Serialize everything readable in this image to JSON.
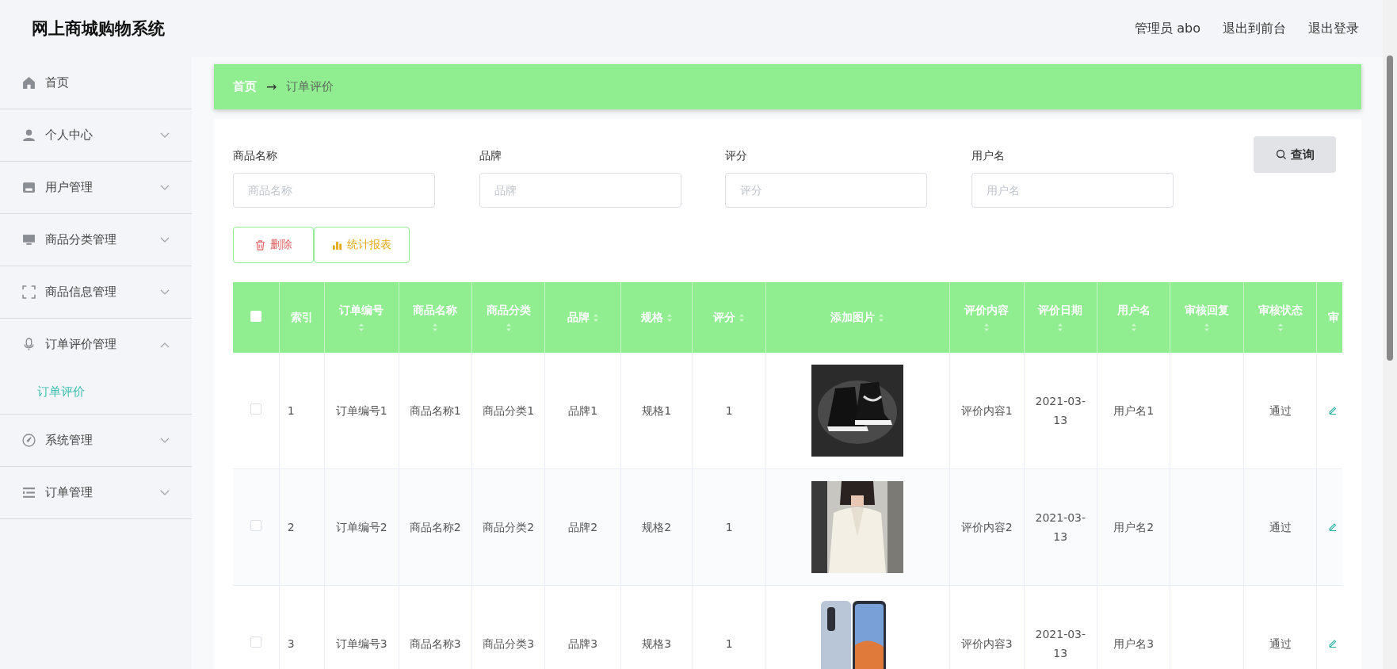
{
  "app_title": "网上商城购物系统",
  "header_links": [
    "管理员 abo",
    "退出到前台",
    "退出登录"
  ],
  "sidebar": {
    "items": [
      {
        "label": "首页",
        "kind": "link"
      },
      {
        "label": "个人中心",
        "kind": "submenu",
        "expanded": false
      },
      {
        "label": "用户管理",
        "kind": "submenu",
        "expanded": false
      },
      {
        "label": "商品分类管理",
        "kind": "submenu",
        "expanded": false
      },
      {
        "label": "商品信息管理",
        "kind": "submenu",
        "expanded": false
      },
      {
        "label": "订单评价管理",
        "kind": "submenu",
        "expanded": true,
        "children": [
          {
            "label": "订单评价",
            "selected": true
          }
        ]
      },
      {
        "label": "系统管理",
        "kind": "submenu",
        "expanded": false
      },
      {
        "label": "订单管理",
        "kind": "submenu",
        "expanded": false
      }
    ]
  },
  "breadcrumb": {
    "items": [
      "首页",
      "订单评价"
    ],
    "separator": "→"
  },
  "search": {
    "fields": [
      {
        "label": "商品名称",
        "placeholder": "商品名称"
      },
      {
        "label": "品牌",
        "placeholder": "品牌"
      },
      {
        "label": "评分",
        "placeholder": "评分"
      },
      {
        "label": "用户名",
        "placeholder": "用户名"
      }
    ],
    "button": "查询"
  },
  "actions": [
    {
      "label": "删除",
      "kind": "delete"
    },
    {
      "label": "统计报表",
      "kind": "report"
    }
  ],
  "table": {
    "columns": [
      {
        "kind": "checkbox",
        "checked": false
      },
      {
        "label": "索引"
      },
      {
        "label": "订单编号",
        "sortable": true
      },
      {
        "label": "商品名称",
        "sortable": true
      },
      {
        "label": "商品分类",
        "sortable": true
      },
      {
        "label": "品牌",
        "sortable": true
      },
      {
        "label": "规格",
        "sortable": true
      },
      {
        "label": "评分",
        "sortable": true
      },
      {
        "label": "添加图片",
        "sortable": true
      },
      {
        "label": "评价内容",
        "sortable": true
      },
      {
        "label": "评价日期",
        "sortable": true
      },
      {
        "label": "用户名",
        "sortable": true
      },
      {
        "label": "审核回复",
        "sortable": true
      },
      {
        "label": "审核状态",
        "sortable": true
      },
      {
        "label": "审"
      }
    ],
    "rows": [
      {
        "cells": [
          {
            "kind": "checkbox",
            "checked": false
          },
          "1",
          "订单编号1",
          "商品名称1",
          "商品分类1",
          "品牌1",
          "规格1",
          "1",
          {
            "kind": "picture"
          },
          "评价内容1",
          "2021-03-13",
          "用户名1",
          "",
          "通过",
          {
            "kind": "edit"
          }
        ]
      },
      {
        "cells": [
          {
            "kind": "checkbox",
            "checked": false
          },
          "2",
          "订单编号2",
          "商品名称2",
          "商品分类2",
          "品牌2",
          "规格2",
          "1",
          {
            "kind": "picture"
          },
          "评价内容2",
          "2021-03-13",
          "用户名2",
          "",
          "通过",
          {
            "kind": "edit"
          }
        ]
      },
      {
        "cells": [
          {
            "kind": "checkbox",
            "checked": false
          },
          "3",
          "订单编号3",
          "商品名称3",
          "商品分类3",
          "品牌3",
          "规格3",
          "1",
          {
            "kind": "picture"
          },
          "评价内容3",
          "2021-03-13",
          "用户名3",
          "",
          "通过",
          {
            "kind": "edit"
          }
        ]
      }
    ]
  }
}
